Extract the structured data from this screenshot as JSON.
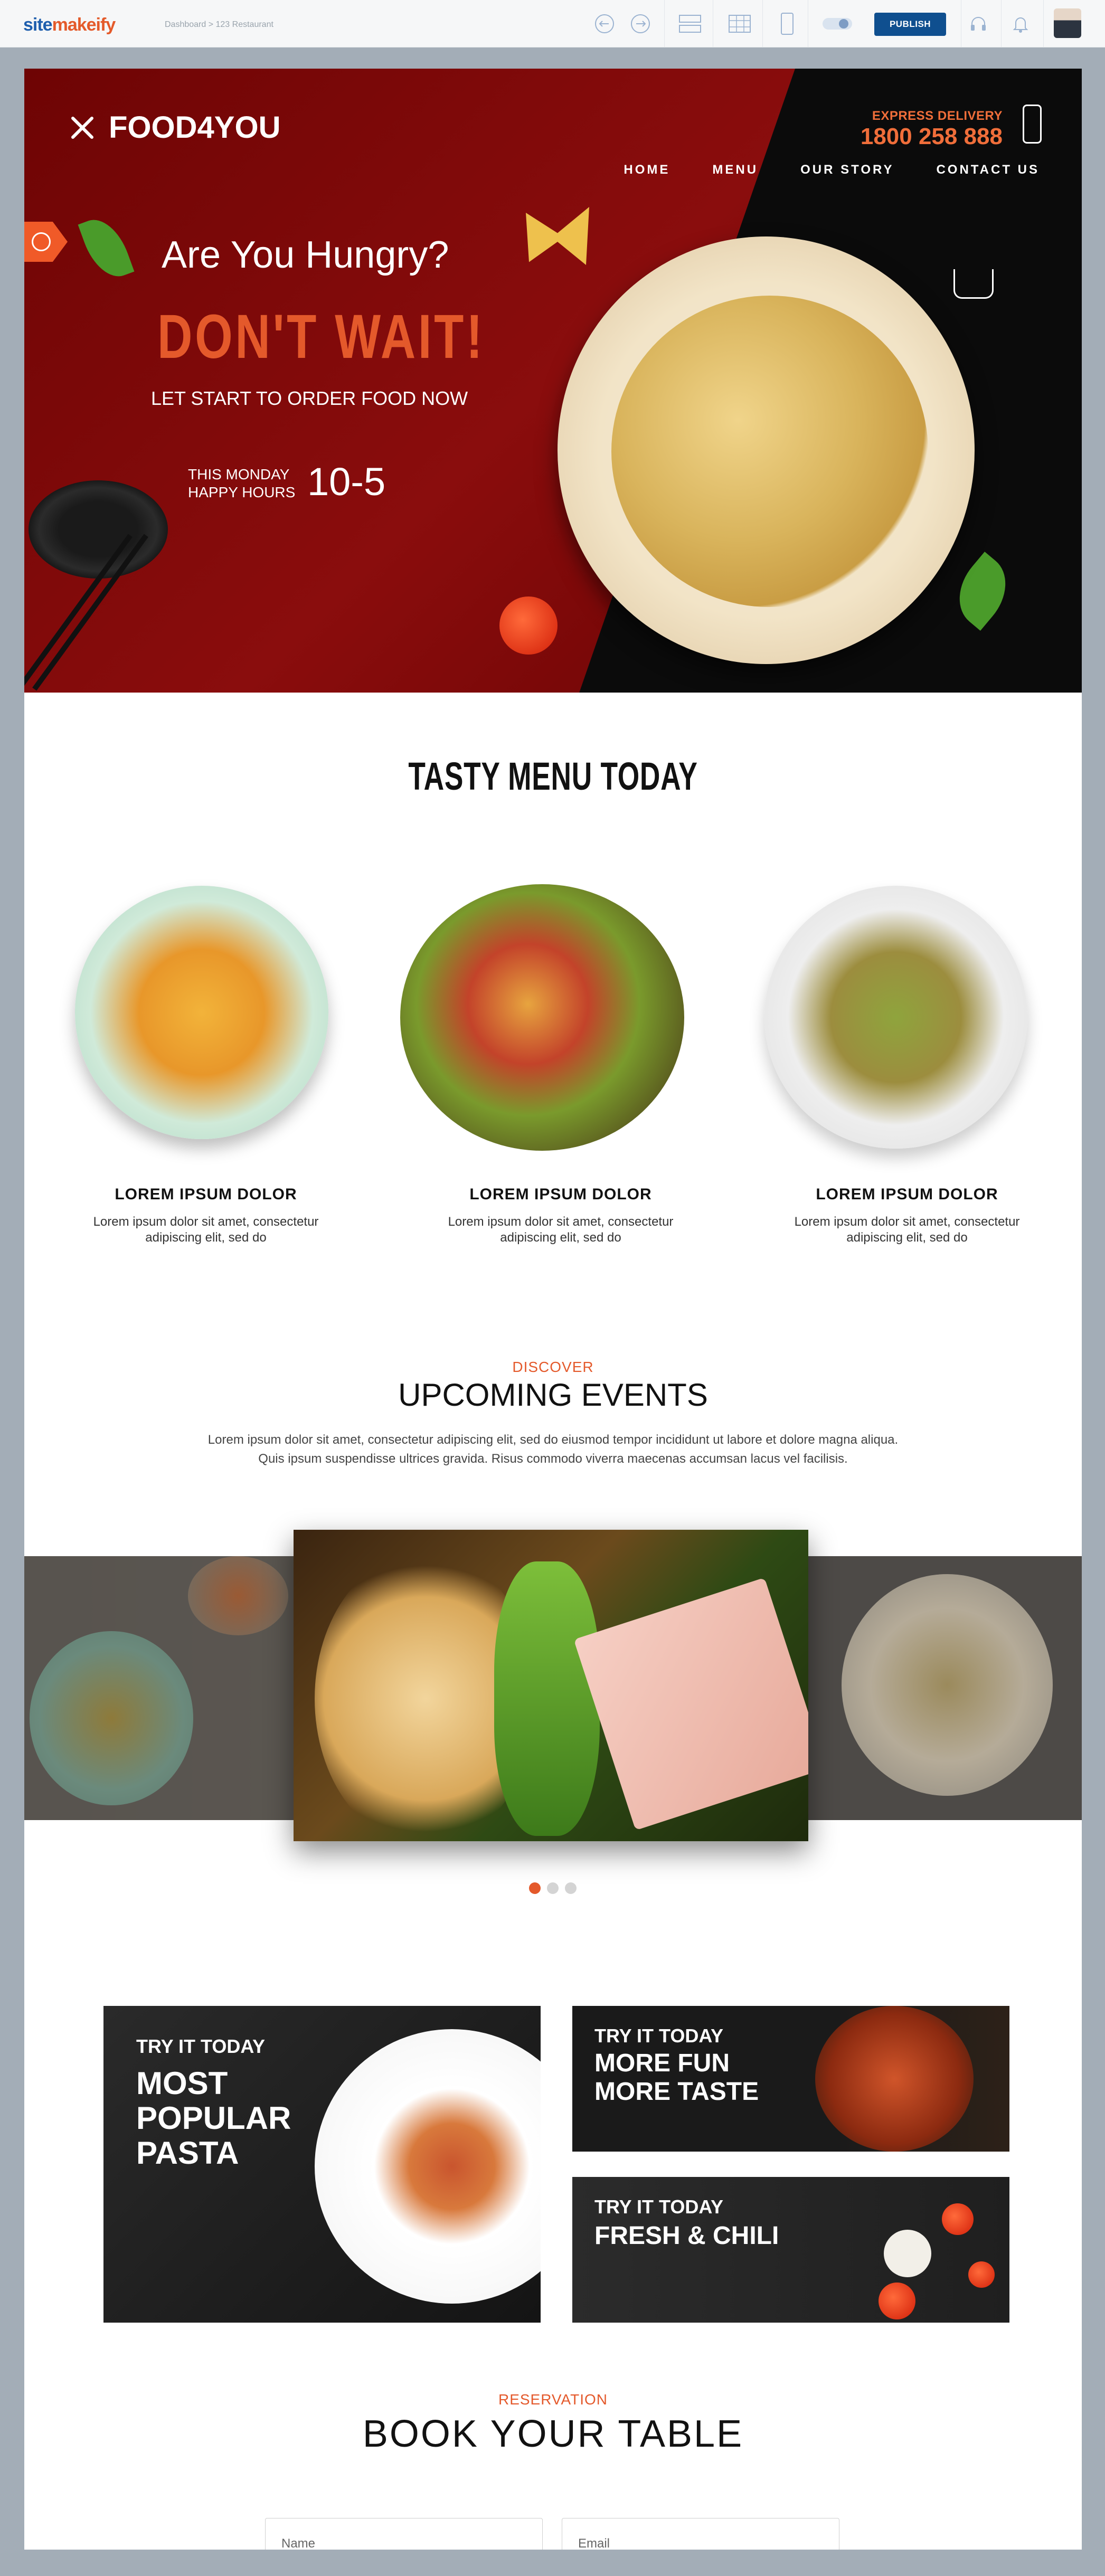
{
  "editor": {
    "logo_part1": "site",
    "logo_part2": "makeify",
    "breadcrumb": "Dashboard > 123 Restaurant",
    "publish_label": "PUBLISH"
  },
  "hero": {
    "brand": "FOOD4YOU",
    "express_label": "EXPRESS DELIVERY",
    "phone": "1800 258 888",
    "nav": [
      "HOME",
      "MENU",
      "OUR STORY",
      "CONTACT US"
    ],
    "headline": "Are You Hungry?",
    "cta_big": "DON'T WAIT!",
    "subline": "LET START TO ORDER FOOD NOW",
    "happy_line1": "THIS MONDAY",
    "happy_line2": "HAPPY HOURS",
    "hours": "10-5"
  },
  "menu": {
    "title": "TASTY MENU TODAY",
    "items": [
      {
        "name": "LOREM IPSUM DOLOR",
        "desc1": "Lorem ipsum dolor sit amet, consectetur",
        "desc2": "adipiscing elit, sed do"
      },
      {
        "name": "LOREM IPSUM DOLOR",
        "desc1": "Lorem ipsum dolor sit amet, consectetur",
        "desc2": "adipiscing elit, sed do"
      },
      {
        "name": "LOREM IPSUM DOLOR",
        "desc1": "Lorem ipsum dolor sit amet, consectetur",
        "desc2": "adipiscing elit, sed do"
      }
    ]
  },
  "events": {
    "kicker": "DISCOVER",
    "title": "UPCOMING EVENTS",
    "text1": "Lorem ipsum dolor sit amet, consectetur adipiscing elit, sed do eiusmod tempor incididunt ut labore et dolore magna aliqua.",
    "text2": "Quis ipsum suspendisse ultrices gravida. Risus commodo viverra maecenas accumsan lacus vel facilisis."
  },
  "promos": [
    {
      "kicker": "TRY IT TODAY",
      "line1": "MOST",
      "line2": "POPULAR",
      "line3": "PASTA"
    },
    {
      "kicker": "TRY IT TODAY",
      "line1": "MORE FUN",
      "line2": "MORE TASTE"
    },
    {
      "kicker": "TRY IT TODAY",
      "line1": "FRESH & CHILI"
    }
  ],
  "reservation": {
    "kicker": "RESERVATION",
    "title": "BOOK YOUR TABLE",
    "name_placeholder": "Name",
    "email_placeholder": "Email"
  },
  "colors": {
    "accent": "#e4592b",
    "hero_red": "#7a0808",
    "publish": "#0f4f8f"
  }
}
